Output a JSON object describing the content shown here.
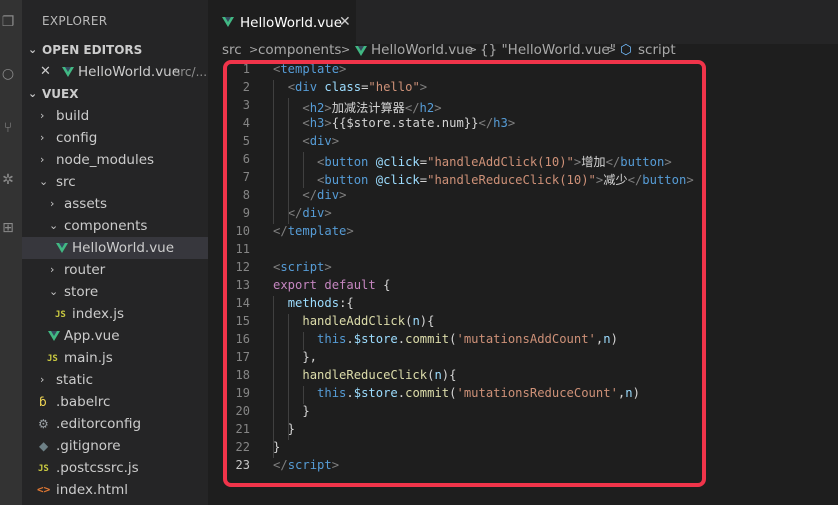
{
  "explorer": {
    "title": "EXPLORER",
    "open_editors_label": "OPEN EDITORS",
    "open_editor_item": {
      "name": "HelloWorld.vue",
      "path": "src/..."
    },
    "project_label": "VUEX",
    "tree": [
      {
        "name": "build",
        "type": "folder",
        "expanded": false
      },
      {
        "name": "config",
        "type": "folder",
        "expanded": false
      },
      {
        "name": "node_modules",
        "type": "folder",
        "expanded": false
      },
      {
        "name": "src",
        "type": "folder",
        "expanded": true
      },
      {
        "name": "assets",
        "type": "folder",
        "expanded": false
      },
      {
        "name": "components",
        "type": "folder",
        "expanded": true
      },
      {
        "name": "HelloWorld.vue",
        "type": "vue",
        "selected": true
      },
      {
        "name": "router",
        "type": "folder",
        "expanded": false
      },
      {
        "name": "store",
        "type": "folder",
        "expanded": true
      },
      {
        "name": "index.js",
        "type": "js"
      },
      {
        "name": "App.vue",
        "type": "vue"
      },
      {
        "name": "main.js",
        "type": "js"
      },
      {
        "name": "static",
        "type": "folder",
        "expanded": false
      },
      {
        "name": ".babelrc",
        "type": "babel"
      },
      {
        "name": ".editorconfig",
        "type": "config"
      },
      {
        "name": ".gitignore",
        "type": "git"
      },
      {
        "name": ".postcssrc.js",
        "type": "js"
      },
      {
        "name": "index.html",
        "type": "html"
      }
    ]
  },
  "tab": {
    "label": "HelloWorld.vue",
    "close_glyph": "✕"
  },
  "breadcrumb": {
    "parts": [
      "src",
      "components",
      "HelloWorld.vue",
      "{} \"HelloWorld.vue\"",
      "script"
    ],
    "separator": ">"
  },
  "editor": {
    "current_line": 23,
    "line_numbers": [
      "1",
      "2",
      "3",
      "4",
      "5",
      "6",
      "7",
      "8",
      "9",
      "10",
      "11",
      "12",
      "13",
      "14",
      "15",
      "16",
      "17",
      "18",
      "19",
      "20",
      "21",
      "22",
      "23"
    ],
    "lines": [
      [
        [
          "br",
          "<"
        ],
        [
          "tg",
          "template"
        ],
        [
          "br",
          ">"
        ]
      ],
      [
        [
          "pl",
          "  "
        ],
        [
          "br",
          "<"
        ],
        [
          "tg",
          "div"
        ],
        [
          "pl",
          " "
        ],
        [
          "at",
          "class"
        ],
        [
          "pl",
          "="
        ],
        [
          "st",
          "\"hello\""
        ],
        [
          "br",
          ">"
        ]
      ],
      [
        [
          "pl",
          "    "
        ],
        [
          "br",
          "<"
        ],
        [
          "tg",
          "h2"
        ],
        [
          "br",
          ">"
        ],
        [
          "tx",
          "加减法计算器"
        ],
        [
          "br",
          "</"
        ],
        [
          "tg",
          "h2"
        ],
        [
          "br",
          ">"
        ]
      ],
      [
        [
          "pl",
          "    "
        ],
        [
          "br",
          "<"
        ],
        [
          "tg",
          "h3"
        ],
        [
          "br",
          ">"
        ],
        [
          "tx",
          "{{$store.state.num}}"
        ],
        [
          "br",
          "</"
        ],
        [
          "tg",
          "h3"
        ],
        [
          "br",
          ">"
        ]
      ],
      [
        [
          "pl",
          "    "
        ],
        [
          "br",
          "<"
        ],
        [
          "tg",
          "div"
        ],
        [
          "br",
          ">"
        ]
      ],
      [
        [
          "pl",
          "      "
        ],
        [
          "br",
          "<"
        ],
        [
          "tg",
          "button"
        ],
        [
          "pl",
          " "
        ],
        [
          "at",
          "@click"
        ],
        [
          "pl",
          "="
        ],
        [
          "st",
          "\"handleAddClick(10)\""
        ],
        [
          "br",
          ">"
        ],
        [
          "tx",
          "增加"
        ],
        [
          "br",
          "</"
        ],
        [
          "tg",
          "button"
        ],
        [
          "br",
          ">"
        ]
      ],
      [
        [
          "pl",
          "      "
        ],
        [
          "br",
          "<"
        ],
        [
          "tg",
          "button"
        ],
        [
          "pl",
          " "
        ],
        [
          "at",
          "@click"
        ],
        [
          "pl",
          "="
        ],
        [
          "st",
          "\"handleReduceClick(10)\""
        ],
        [
          "br",
          ">"
        ],
        [
          "tx",
          "减少"
        ],
        [
          "br",
          "</"
        ],
        [
          "tg",
          "button"
        ],
        [
          "br",
          ">"
        ]
      ],
      [
        [
          "pl",
          "    "
        ],
        [
          "br",
          "</"
        ],
        [
          "tg",
          "div"
        ],
        [
          "br",
          ">"
        ]
      ],
      [
        [
          "pl",
          "  "
        ],
        [
          "br",
          "</"
        ],
        [
          "tg",
          "div"
        ],
        [
          "br",
          ">"
        ]
      ],
      [
        [
          "br",
          "</"
        ],
        [
          "tg",
          "template"
        ],
        [
          "br",
          ">"
        ]
      ],
      [],
      [
        [
          "br",
          "<"
        ],
        [
          "tg",
          "script"
        ],
        [
          "br",
          ">"
        ]
      ],
      [
        [
          "kw",
          "export"
        ],
        [
          "pl",
          " "
        ],
        [
          "kw",
          "default"
        ],
        [
          "pl",
          " {"
        ]
      ],
      [
        [
          "pl",
          "  "
        ],
        [
          "vr",
          "methods"
        ],
        [
          "pl",
          ":{"
        ]
      ],
      [
        [
          "pl",
          "    "
        ],
        [
          "fn",
          "handleAddClick"
        ],
        [
          "pl",
          "("
        ],
        [
          "vr",
          "n"
        ],
        [
          "pl",
          "){"
        ]
      ],
      [
        [
          "pl",
          "      "
        ],
        [
          "tg",
          "this"
        ],
        [
          "pl",
          "."
        ],
        [
          "vr",
          "$store"
        ],
        [
          "pl",
          "."
        ],
        [
          "fn",
          "commit"
        ],
        [
          "pl",
          "("
        ],
        [
          "st",
          "'mutationsAddCount'"
        ],
        [
          "pl",
          ","
        ],
        [
          "vr",
          "n"
        ],
        [
          "pl",
          ")"
        ]
      ],
      [
        [
          "pl",
          "    },"
        ]
      ],
      [
        [
          "pl",
          "    "
        ],
        [
          "fn",
          "handleReduceClick"
        ],
        [
          "pl",
          "("
        ],
        [
          "vr",
          "n"
        ],
        [
          "pl",
          "){"
        ]
      ],
      [
        [
          "pl",
          "      "
        ],
        [
          "tg",
          "this"
        ],
        [
          "pl",
          "."
        ],
        [
          "vr",
          "$store"
        ],
        [
          "pl",
          "."
        ],
        [
          "fn",
          "commit"
        ],
        [
          "pl",
          "("
        ],
        [
          "st",
          "'mutationsReduceCount'"
        ],
        [
          "pl",
          ","
        ],
        [
          "vr",
          "n"
        ],
        [
          "pl",
          ")"
        ]
      ],
      [
        [
          "pl",
          "    }"
        ]
      ],
      [
        [
          "pl",
          "  }"
        ]
      ],
      [
        [
          "pl",
          "}"
        ]
      ],
      [
        [
          "br",
          "</"
        ],
        [
          "tg",
          "script"
        ],
        [
          "br",
          ">"
        ]
      ]
    ]
  },
  "colors": {
    "highlight_border": "#f0344a",
    "vue_green": "#41b883"
  }
}
